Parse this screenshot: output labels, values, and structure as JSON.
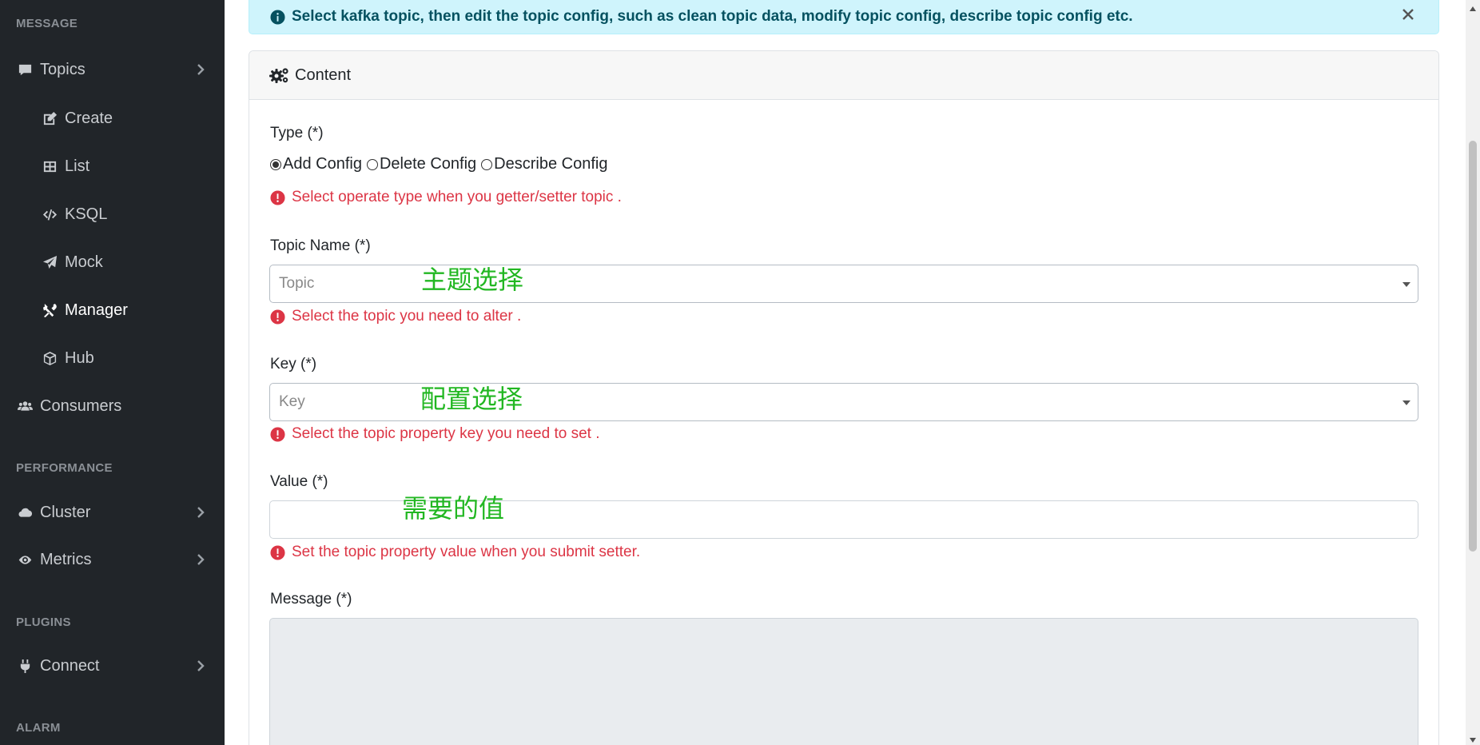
{
  "sidebar": {
    "sections": {
      "message": "MESSAGE",
      "performance": "PERFORMANCE",
      "plugins": "PLUGINS",
      "alarm": "ALARM"
    },
    "items": {
      "topics": "Topics",
      "create": "Create",
      "list": "List",
      "ksql": "KSQL",
      "mock": "Mock",
      "manager": "Manager",
      "hub": "Hub",
      "consumers": "Consumers",
      "cluster": "Cluster",
      "metrics": "Metrics",
      "connect": "Connect"
    },
    "active": "Manager"
  },
  "alert": {
    "text": "Select kafka topic, then edit the topic config, such as clean topic data, modify topic config, describe topic config etc."
  },
  "card": {
    "title": "Content"
  },
  "form": {
    "type": {
      "label": "Type (*)",
      "options": [
        "Add Config",
        "Delete Config",
        "Describe Config"
      ],
      "selected": "Add Config",
      "help": "Select operate type when you getter/setter topic ."
    },
    "topic": {
      "label": "Topic Name (*)",
      "placeholder": "Topic",
      "help": "Select the topic you need to alter ."
    },
    "key": {
      "label": "Key (*)",
      "placeholder": "Key",
      "help": "Select the topic property key you need to set ."
    },
    "value": {
      "label": "Value (*)",
      "value": "",
      "help": "Set the topic property value when you submit setter."
    },
    "message": {
      "label": "Message (*)"
    }
  },
  "annotations": {
    "topic": "主题选择",
    "key": "配置选择",
    "value": "需要的值"
  },
  "colors": {
    "sidebar_bg": "#212529",
    "alert_bg": "#cff4fc",
    "error": "#dc3545",
    "annotation": "#22b722"
  }
}
